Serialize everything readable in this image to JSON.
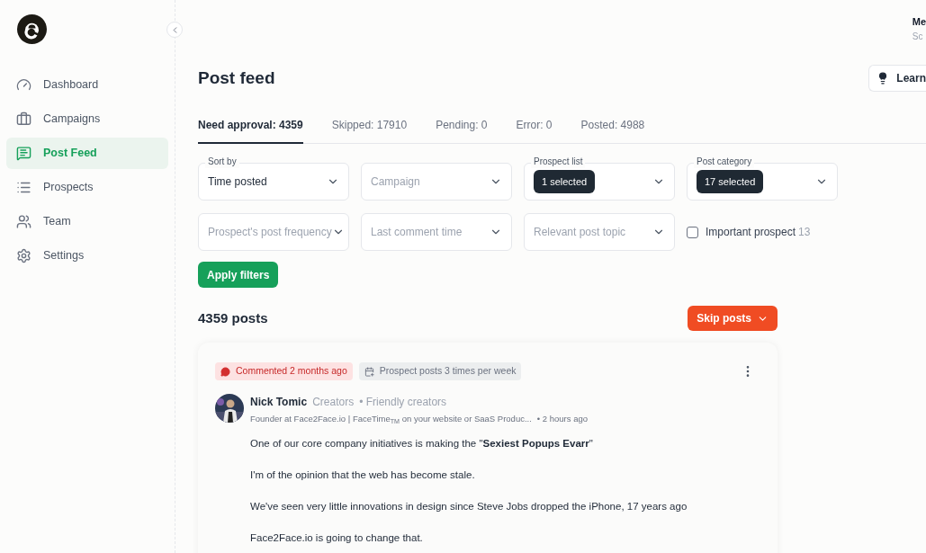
{
  "sidebar": {
    "items": [
      {
        "label": "Dashboard",
        "selected": false
      },
      {
        "label": "Campaigns",
        "selected": false
      },
      {
        "label": "Post Feed",
        "selected": true
      },
      {
        "label": "Prospects",
        "selected": false
      },
      {
        "label": "Team",
        "selected": false
      },
      {
        "label": "Settings",
        "selected": false
      }
    ]
  },
  "user": {
    "name": "Me",
    "subtitle": "Sc"
  },
  "page": {
    "title": "Post feed",
    "learn_button": "Learn"
  },
  "tabs": [
    {
      "label": "Need approval: 4359",
      "selected": true
    },
    {
      "label": "Skipped: 17910",
      "selected": false
    },
    {
      "label": "Pending: 0",
      "selected": false
    },
    {
      "label": "Error: 0",
      "selected": false
    },
    {
      "label": "Posted: 4988",
      "selected": false
    }
  ],
  "filters": [
    {
      "label": "Sort by",
      "kind": "value",
      "text": "Time posted"
    },
    {
      "kind": "placeholder",
      "text": "Campaign"
    },
    {
      "label": "Prospect list",
      "kind": "chip",
      "text": "1 selected"
    },
    {
      "label": "Post category",
      "kind": "chip",
      "text": "17 selected"
    },
    {
      "kind": "placeholder",
      "text": "Prospect's post frequency"
    },
    {
      "kind": "placeholder",
      "text": "Last comment time"
    },
    {
      "kind": "placeholder",
      "text": "Relevant post topic"
    }
  ],
  "important_prospect": {
    "label": "Important prospect",
    "count": "13",
    "checked": false
  },
  "apply_button": "Apply filters",
  "post_count": "4359 posts",
  "skip_button": "Skip posts",
  "post": {
    "tags": [
      {
        "kind": "comment",
        "text": "Commented 2 months ago"
      },
      {
        "kind": "frequency",
        "text": "Prospect posts 3 times per week"
      }
    ],
    "author": "Nick Tomic",
    "group": "Creators",
    "category": "• Friendly creators",
    "headline": "Founder at Face2Face.io | FaceTime$_{TM}$ on your website or SaaS Produc...",
    "time": "• 2 hours ago",
    "paragraphs": [
      "One of our core company initiatives is making the \"**Sexiest Popups Evarr**\"",
      "I'm of the opinion that the web has become stale.",
      "We've seen very little innovations in design since Steve Jobs dropped the iPhone, 17 years ago",
      "Face2Face.io is going to change that."
    ]
  }
}
